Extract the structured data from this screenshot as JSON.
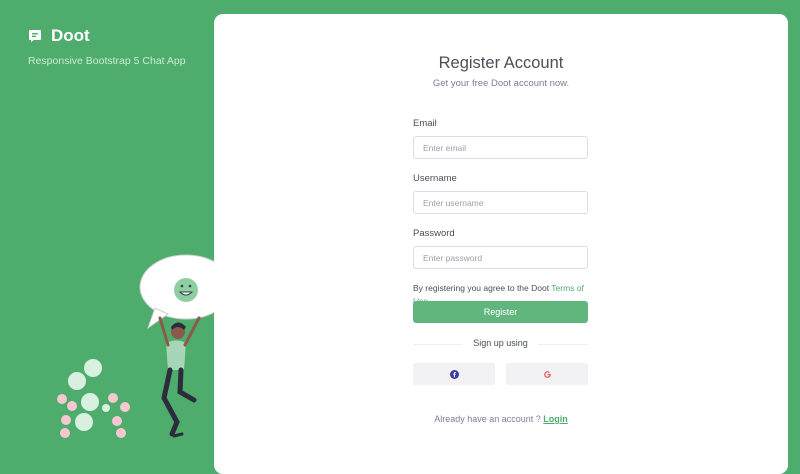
{
  "brand": {
    "name": "Doot",
    "tagline": "Responsive Bootstrap 5 Chat App",
    "logo_icon": "chat-bubble-icon"
  },
  "colors": {
    "brand_green": "#4eac6d",
    "button_green": "#61b67e",
    "text_dark": "#495057",
    "text_muted": "#7a7f9a"
  },
  "register": {
    "title": "Register Account",
    "subtitle": "Get your free Doot account now.",
    "email_label": "Email",
    "email_placeholder": "Enter email",
    "username_label": "Username",
    "username_placeholder": "Enter username",
    "password_label": "Password",
    "password_placeholder": "Enter password",
    "terms_text": "By registering you agree to the Doot ",
    "terms_link": "Terms of Use",
    "register_button": "Register",
    "signup_using": "Sign up using",
    "social": [
      {
        "name": "facebook",
        "icon": "facebook-icon"
      },
      {
        "name": "google",
        "icon": "google-icon"
      }
    ],
    "already_text": "Already have an account ? ",
    "login_link": "Login"
  }
}
